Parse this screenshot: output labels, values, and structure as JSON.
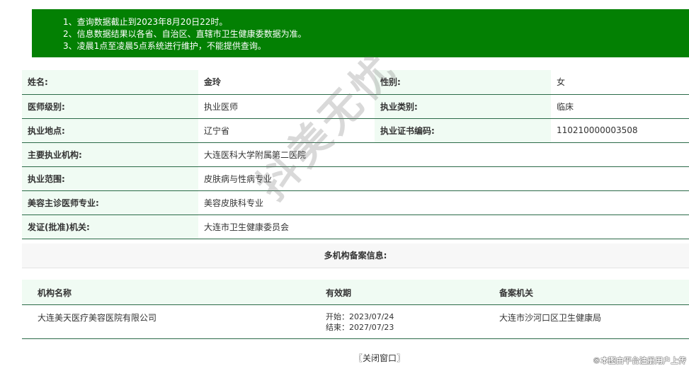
{
  "notice": {
    "lines": [
      "1、查询数据截止到2023年8月20日22时。",
      "2、信息数据结果以各省、自治区、直辖市卫生健康委数据为准。",
      "3、凌晨1点至凌晨5点系统进行维护，不能提供查询。"
    ]
  },
  "info": {
    "name_label": "姓名:",
    "name_value": "金玲",
    "gender_label": "性别:",
    "gender_value": "女",
    "level_label": "医师级别:",
    "level_value": "执业医师",
    "category_label": "执业类别:",
    "category_value": "临床",
    "location_label": "执业地点:",
    "location_value": "辽宁省",
    "cert_label": "执业证书编码:",
    "cert_value": "110210000003508",
    "org_label": "主要执业机构:",
    "org_value": "大连医科大学附属第二医院",
    "scope_label": "执业范围:",
    "scope_value": "皮肤病与性病专业",
    "cosmetic_label": "美容主诊医师专业:",
    "cosmetic_value": "美容皮肤科专业",
    "issuer_label": "发证(批准)机关:",
    "issuer_value": "大连市卫生健康委员会"
  },
  "multi": {
    "title": "多机构备案信息:",
    "headers": [
      "机构名称",
      "有效期",
      "备案机关"
    ],
    "rows": [
      {
        "name": "大连美天医疗美容医院有限公司",
        "start": "开始：2023/07/24",
        "end": "结束：2027/07/23",
        "authority": "大连市沙河口区卫生健康局"
      }
    ]
  },
  "close_label": "〖关闭窗口〗",
  "watermark": "抖美无忧",
  "footer_note": "©本图由平台注册用户上传"
}
